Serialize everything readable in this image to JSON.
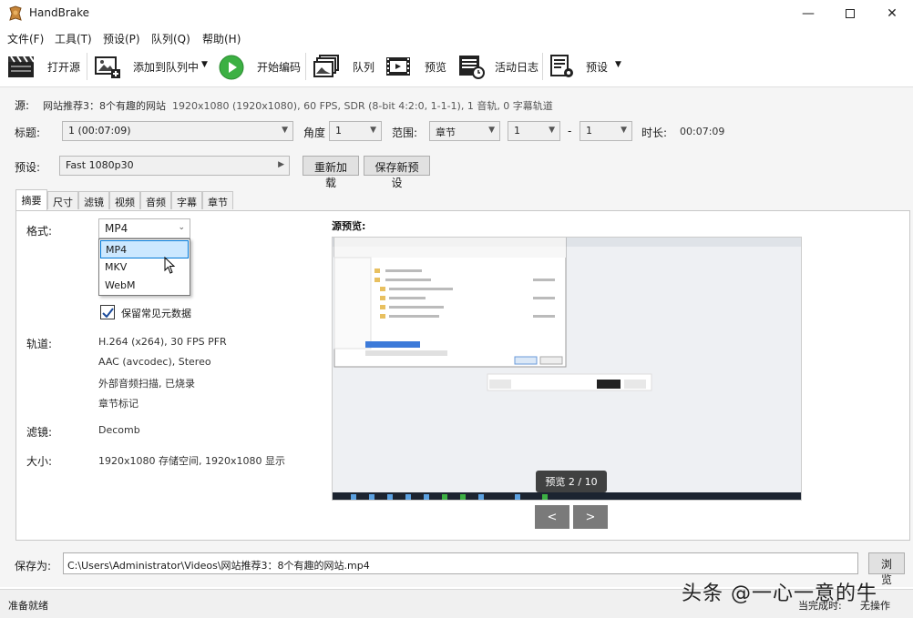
{
  "window": {
    "title": "HandBrake"
  },
  "menu": [
    "文件(F)",
    "工具(T)",
    "预设(P)",
    "队列(Q)",
    "帮助(H)"
  ],
  "toolbar": {
    "open_source": "打开源",
    "add_to_queue": "添加到队列中",
    "start_encode": "开始编码",
    "queue": "队列",
    "preview": "预览",
    "activity_log": "活动日志",
    "presets": "预设"
  },
  "source": {
    "label": "源:",
    "name": "网站推荐3：8个有趣的网站",
    "info": "1920x1080 (1920x1080), 60 FPS, SDR (8-bit 4:2:0, 1-1-1), 1 音轨, 0 字幕轨道"
  },
  "title_row": {
    "title_label": "标题:",
    "title_value": "1 (00:07:09)",
    "angle_label": "角度",
    "angle_value": "1",
    "range_label": "范围:",
    "range_type": "章节",
    "range_start": "1",
    "range_sep": "-",
    "range_end": "1",
    "duration_label": "时长:",
    "duration_value": "00:07:09"
  },
  "preset_row": {
    "label": "预设:",
    "value": "Fast 1080p30",
    "reload_button": "重新加载",
    "save_new_button": "保存新预设"
  },
  "tabs": [
    "摘要",
    "尺寸",
    "滤镜",
    "视频",
    "音频",
    "字幕",
    "章节"
  ],
  "summary": {
    "format_label": "格式:",
    "format_value": "MP4",
    "format_options": [
      "MP4",
      "MKV",
      "WebM"
    ],
    "keep_metadata": "保留常见元数据",
    "tracks_label": "轨道:",
    "tracks": [
      "H.264 (x264), 30 FPS PFR",
      "AAC (avcodec), Stereo",
      "外部音频扫描, 已烧录",
      "章节标记"
    ],
    "filters_label": "滤镜:",
    "filters_value": "Decomb",
    "size_label": "大小:",
    "size_value": "1920x1080 存储空间, 1920x1080 显示",
    "source_preview_label": "源预览:",
    "preview_counter": "预览 2 / 10",
    "prev_button": "<",
    "next_button": ">"
  },
  "save_as": {
    "label": "保存为:",
    "path": "C:\\Users\\Administrator\\Videos\\网站推荐3：8个有趣的网站.mp4",
    "browse_button": "浏览"
  },
  "status": {
    "text": "准备就绪",
    "when_done_label": "当完成时:",
    "when_done_value": "无操作"
  },
  "watermark": "头条 @一心一意的牛",
  "colors": {
    "accent": "#0078d7",
    "play_green": "#3cb043",
    "selection": "#cce8ff"
  }
}
